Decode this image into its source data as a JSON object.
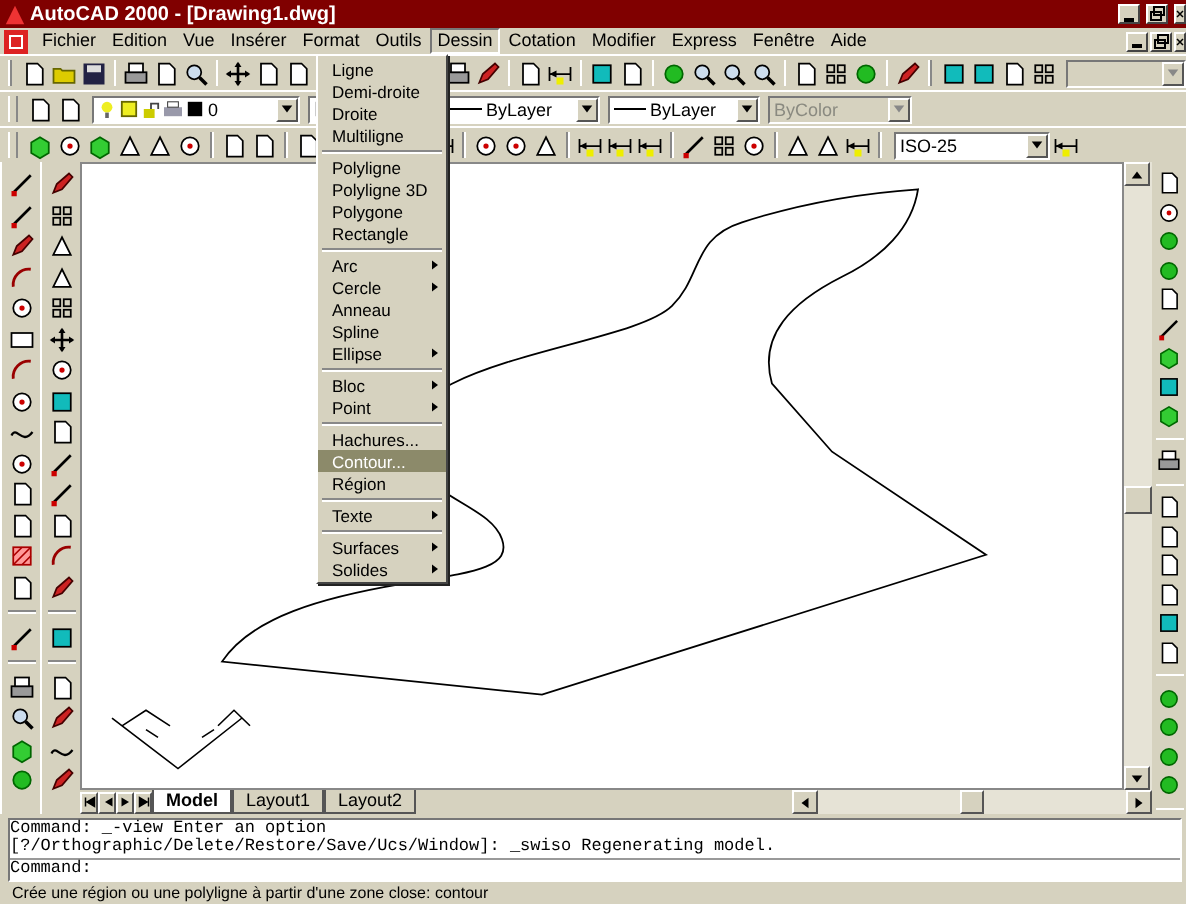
{
  "window": {
    "title": "AutoCAD 2000 - [Drawing1.dwg]"
  },
  "menu_bar": [
    {
      "label": "Fichier",
      "selected": false
    },
    {
      "label": "Edition",
      "selected": false
    },
    {
      "label": "Vue",
      "selected": false
    },
    {
      "label": "Insérer",
      "selected": false
    },
    {
      "label": "Format",
      "selected": false
    },
    {
      "label": "Outils",
      "selected": false
    },
    {
      "label": "Dessin",
      "selected": true
    },
    {
      "label": "Cotation",
      "selected": false
    },
    {
      "label": "Modifier",
      "selected": false
    },
    {
      "label": "Express",
      "selected": false
    },
    {
      "label": "Fenêtre",
      "selected": false
    },
    {
      "label": "Aide",
      "selected": false
    }
  ],
  "toolbars": {
    "view_combo": {
      "disabled": true
    },
    "layer": {
      "value": "0"
    },
    "linetype": {
      "value": "ByLayer"
    },
    "lineweight": {
      "value": "ByLayer"
    },
    "plot_style": {
      "value": "ByColor",
      "disabled": true
    },
    "dim_style": {
      "value": "ISO-25"
    }
  },
  "dropdown_menu": {
    "sections": [
      [
        {
          "label": "Ligne",
          "submenu": false,
          "selected": false
        },
        {
          "label": "Demi-droite",
          "submenu": false,
          "selected": false
        },
        {
          "label": "Droite",
          "submenu": false,
          "selected": false
        },
        {
          "label": "Multiligne",
          "submenu": false,
          "selected": false
        }
      ],
      [
        {
          "label": "Polyligne",
          "submenu": false,
          "selected": false
        },
        {
          "label": "Polyligne 3D",
          "submenu": false,
          "selected": false
        },
        {
          "label": "Polygone",
          "submenu": false,
          "selected": false
        },
        {
          "label": "Rectangle",
          "submenu": false,
          "selected": false
        }
      ],
      [
        {
          "label": "Arc",
          "submenu": true,
          "selected": false
        },
        {
          "label": "Cercle",
          "submenu": true,
          "selected": false
        },
        {
          "label": "Anneau",
          "submenu": false,
          "selected": false
        },
        {
          "label": "Spline",
          "submenu": false,
          "selected": false
        },
        {
          "label": "Ellipse",
          "submenu": true,
          "selected": false
        }
      ],
      [
        {
          "label": "Bloc",
          "submenu": true,
          "selected": false
        },
        {
          "label": "Point",
          "submenu": true,
          "selected": false
        }
      ],
      [
        {
          "label": "Hachures...",
          "submenu": false,
          "selected": false
        },
        {
          "label": "Contour...",
          "submenu": false,
          "selected": true
        },
        {
          "label": "Région",
          "submenu": false,
          "selected": false
        }
      ],
      [
        {
          "label": "Texte",
          "submenu": true,
          "selected": false
        }
      ],
      [
        {
          "label": "Surfaces",
          "submenu": true,
          "selected": false
        },
        {
          "label": "Solides",
          "submenu": true,
          "selected": false
        }
      ]
    ]
  },
  "drawing_tabs": [
    {
      "label": "Model",
      "selected": true
    },
    {
      "label": "Layout1",
      "selected": false
    },
    {
      "label": "Layout2",
      "selected": false
    }
  ],
  "command_history": [
    "Command: _-view Enter an option",
    "[?/Orthographic/Delete/Restore/Save/Ucs/Window]: _swiso Regenerating model."
  ],
  "command_prompt": "Command:",
  "status_bar": "Crée une région ou une polyligne à partir d'une zone close: contour"
}
